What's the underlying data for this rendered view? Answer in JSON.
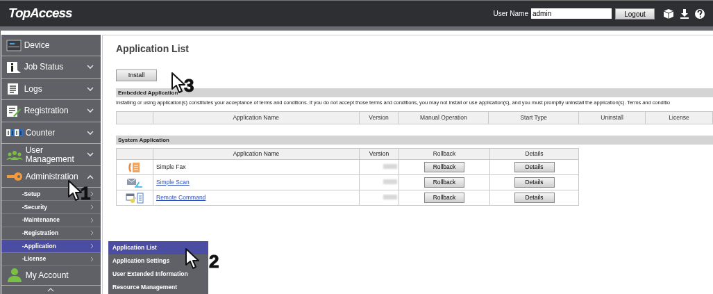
{
  "header": {
    "logo": "TopAccess",
    "user_label": "User Name",
    "user_value": "admin",
    "logout": "Logout"
  },
  "sidebar": [
    {
      "label": "Device",
      "kind": "plain"
    },
    {
      "label": "Job Status",
      "kind": "group",
      "expanded": false
    },
    {
      "label": "Logs",
      "kind": "group",
      "expanded": false
    },
    {
      "label": "Registration",
      "kind": "group",
      "expanded": false
    },
    {
      "label": "Counter",
      "kind": "group",
      "expanded": false
    },
    {
      "label": "User Management",
      "kind": "group",
      "expanded": false
    },
    {
      "label": "Administration",
      "kind": "group",
      "expanded": true,
      "children": [
        {
          "label": "-Setup",
          "selected": false
        },
        {
          "label": "-Security",
          "selected": false
        },
        {
          "label": "-Maintenance",
          "selected": false
        },
        {
          "label": "-Registration",
          "selected": false
        },
        {
          "label": "-Application",
          "selected": true
        },
        {
          "label": "-License",
          "selected": false
        }
      ]
    },
    {
      "label": "My Account",
      "kind": "plain"
    }
  ],
  "flyout": [
    {
      "label": "Application List",
      "selected": true
    },
    {
      "label": "Application Settings",
      "selected": false
    },
    {
      "label": "User Extended Information",
      "selected": false
    },
    {
      "label": "Resource Management",
      "selected": false
    }
  ],
  "page": {
    "title": "Application List",
    "install": "Install",
    "embedded": {
      "heading": "Embedded Application",
      "notice": "Installing or using application(s) constitutes your acceptance of terms and conditions. If you do not accept those terms and conditions, you may not install or use application(s), and you must promptly uninstall the application(s). Terms and conditio",
      "columns": [
        "Application Name",
        "Version",
        "Manual Operation",
        "Start Type",
        "Uninstall",
        "License"
      ]
    },
    "system": {
      "heading": "System Application",
      "columns": [
        "Application Name",
        "Version",
        "Rollback",
        "Details"
      ],
      "rows": [
        {
          "name": "Simple Fax",
          "link": false,
          "rollback": "Rollback",
          "details": "Details"
        },
        {
          "name": "Simple Scan",
          "link": true,
          "rollback": "Rollback",
          "details": "Details"
        },
        {
          "name": "Remote Command",
          "link": true,
          "rollback": "Rollback",
          "details": "Details"
        }
      ]
    }
  },
  "callouts": [
    "1",
    "2",
    "3"
  ]
}
